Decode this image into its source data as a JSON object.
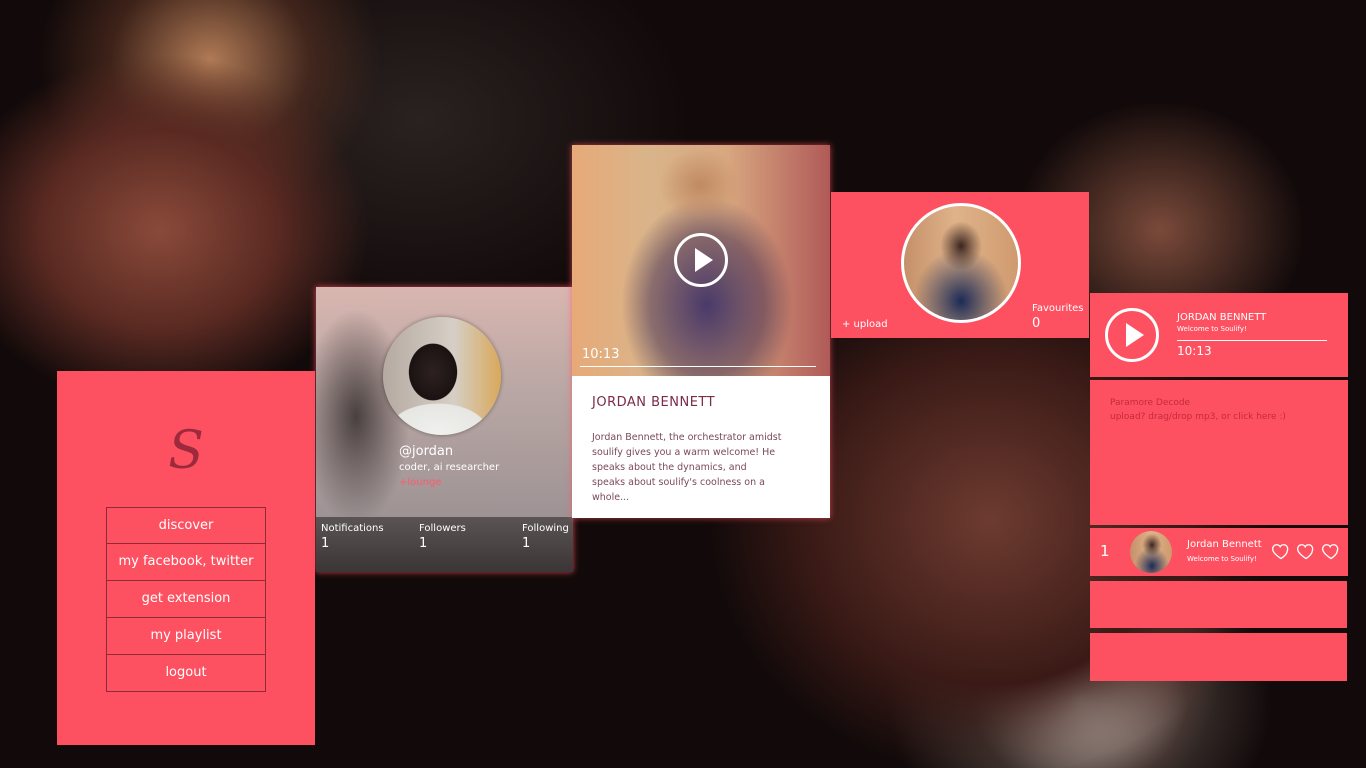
{
  "menu": {
    "logo": "S",
    "items": [
      "discover",
      "my facebook, twitter",
      "get extension",
      "my playlist",
      "logout"
    ]
  },
  "profile": {
    "handle": "@jordan",
    "bio": "coder, ai researcher",
    "lounge": "+lounge",
    "stats": [
      {
        "label": "Notifications",
        "value": "1"
      },
      {
        "label": "Followers",
        "value": "1"
      },
      {
        "label": "Following",
        "value": "1"
      }
    ]
  },
  "video": {
    "time": "10:13",
    "title": "JORDAN BENNETT",
    "description": "Jordan Bennett, the orchestrator amidst soulify gives you a warm welcome! He speaks about the dynamics, and speaks about soulify's coolness on a whole..."
  },
  "upload": {
    "link": "+ upload",
    "favourites_label": "Favourites",
    "favourites_value": "0"
  },
  "player": {
    "artist": "JORDAN BENNETT",
    "subtitle": "Welcome to Soulify!",
    "time": "10:13"
  },
  "drop": {
    "title": "Paramore Decode",
    "hint": "upload? drag/drop mp3, or click here :)"
  },
  "track": {
    "number": "1",
    "artist": "Jordan Bennett",
    "subtitle": "Welcome to Soulify!"
  },
  "colors": {
    "accent": "#fd5161",
    "border": "#8f2a38"
  },
  "icons": [
    "play-icon",
    "heart-icon",
    "avatar"
  ]
}
